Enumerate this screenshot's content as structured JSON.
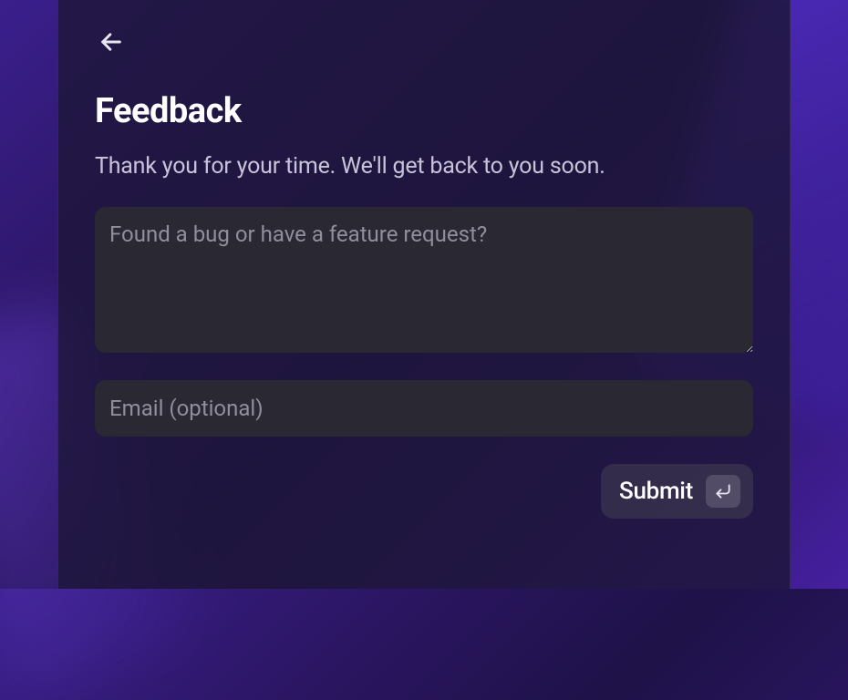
{
  "page": {
    "title": "Feedback",
    "subtitle": "Thank you for your time. We'll get back to you soon."
  },
  "form": {
    "message": {
      "value": "",
      "placeholder": "Found a bug or have a feature request?"
    },
    "email": {
      "value": "",
      "placeholder": "Email (optional)"
    },
    "submit_label": "Submit"
  }
}
